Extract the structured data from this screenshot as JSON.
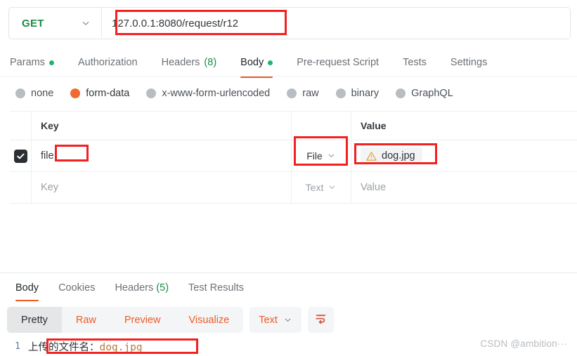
{
  "request": {
    "method": "GET",
    "method_color": "#1a8b45",
    "url": "127.0.0.1:8080/request/r12",
    "tabs": [
      {
        "label": "Params",
        "dot": true,
        "count": "",
        "active": false
      },
      {
        "label": "Authorization",
        "dot": false,
        "count": "",
        "active": false
      },
      {
        "label": "Headers",
        "dot": false,
        "count": "(8)",
        "active": false
      },
      {
        "label": "Body",
        "dot": true,
        "count": "",
        "active": true
      },
      {
        "label": "Pre-request Script",
        "dot": false,
        "count": "",
        "active": false
      },
      {
        "label": "Tests",
        "dot": false,
        "count": "",
        "active": false
      },
      {
        "label": "Settings",
        "dot": false,
        "count": "",
        "active": false
      }
    ],
    "body_modes": [
      {
        "label": "none",
        "selected": false
      },
      {
        "label": "form-data",
        "selected": true
      },
      {
        "label": "x-www-form-urlencoded",
        "selected": false
      },
      {
        "label": "raw",
        "selected": false
      },
      {
        "label": "binary",
        "selected": false
      },
      {
        "label": "GraphQL",
        "selected": false
      }
    ]
  },
  "form_table": {
    "headers": {
      "key": "Key",
      "value": "Value"
    },
    "row": {
      "checked": true,
      "key": "file",
      "type": "File",
      "value": "dog.jpg",
      "warning_icon": "warning-triangle-icon"
    },
    "empty_row": {
      "key_placeholder": "Key",
      "type": "Text",
      "value_placeholder": "Value"
    }
  },
  "response": {
    "tabs": [
      {
        "label": "Body",
        "count": "",
        "active": true
      },
      {
        "label": "Cookies",
        "count": "",
        "active": false
      },
      {
        "label": "Headers",
        "count": "(5)",
        "active": false
      },
      {
        "label": "Test Results",
        "count": "",
        "active": false
      }
    ],
    "view_modes": [
      {
        "label": "Pretty",
        "active": true
      },
      {
        "label": "Raw",
        "active": false
      },
      {
        "label": "Preview",
        "active": false
      },
      {
        "label": "Visualize",
        "active": false
      }
    ],
    "format": "Text",
    "wrap_icon": "word-wrap-icon",
    "body": {
      "line_number": "1",
      "prefix": "上传的文件名：",
      "filename": "dog.jpg"
    }
  },
  "watermark": "CSDN @ambition···",
  "colors": {
    "accent_orange": "#ef5b25",
    "method_green": "#1a8b45",
    "dot_green": "#23b26d",
    "annotation_red": "#f32020",
    "radio_selected": "#ef6b33",
    "warning_amber": "#e8a33d"
  }
}
